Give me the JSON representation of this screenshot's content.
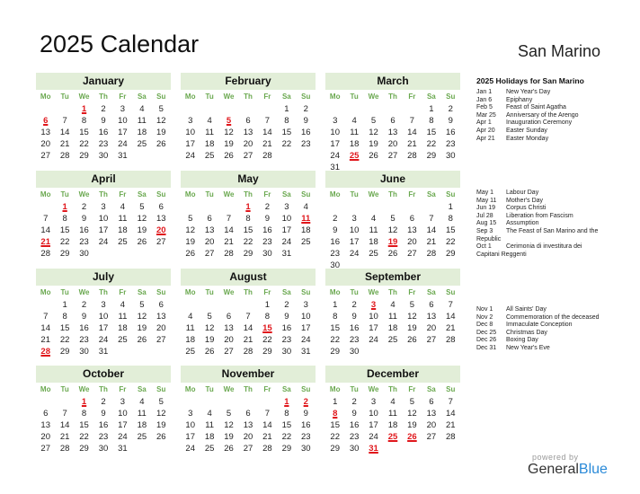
{
  "title": "2025 Calendar",
  "country": "San Marino",
  "weekdays": [
    "Mo",
    "Tu",
    "We",
    "Th",
    "Fr",
    "Sa",
    "Su"
  ],
  "colors": {
    "accent_green": "#6aa84f",
    "header_bg": "#e2eed8",
    "holiday_red": "#e0161b",
    "brand_blue": "#2a8ad8"
  },
  "months": [
    {
      "name": "January",
      "offset": 2,
      "days": 31,
      "holidays": [
        1,
        6
      ]
    },
    {
      "name": "February",
      "offset": 5,
      "days": 28,
      "holidays": [
        5
      ]
    },
    {
      "name": "March",
      "offset": 5,
      "days": 31,
      "holidays": [
        25
      ]
    },
    {
      "name": "April",
      "offset": 1,
      "days": 30,
      "holidays": [
        1,
        20,
        21
      ]
    },
    {
      "name": "May",
      "offset": 3,
      "days": 31,
      "holidays": [
        1,
        11
      ]
    },
    {
      "name": "June",
      "offset": 6,
      "days": 30,
      "holidays": [
        19
      ]
    },
    {
      "name": "July",
      "offset": 1,
      "days": 31,
      "holidays": [
        28
      ]
    },
    {
      "name": "August",
      "offset": 4,
      "days": 31,
      "holidays": [
        15
      ]
    },
    {
      "name": "September",
      "offset": 0,
      "days": 30,
      "holidays": [
        3
      ]
    },
    {
      "name": "October",
      "offset": 2,
      "days": 31,
      "holidays": [
        1
      ]
    },
    {
      "name": "November",
      "offset": 5,
      "days": 30,
      "holidays": [
        1,
        2
      ]
    },
    {
      "name": "December",
      "offset": 0,
      "days": 31,
      "holidays": [
        8,
        25,
        26,
        31
      ]
    }
  ],
  "holidays_heading": "2025 Holidays for San Marino",
  "holiday_groups": [
    [
      {
        "date": "Jan 1",
        "name": "New Year's Day"
      },
      {
        "date": "Jan 6",
        "name": "Epiphany"
      },
      {
        "date": "Feb 5",
        "name": "Feast of Saint Agatha"
      },
      {
        "date": "Mar 25",
        "name": "Anniversary of the Arengo"
      },
      {
        "date": "Apr 1",
        "name": "Inauguration Ceremony"
      },
      {
        "date": "Apr 20",
        "name": "Easter Sunday"
      },
      {
        "date": "Apr 21",
        "name": "Easter Monday"
      }
    ],
    [
      {
        "date": "May 1",
        "name": "Labour Day"
      },
      {
        "date": "May 11",
        "name": "Mother's Day"
      },
      {
        "date": "Jun 19",
        "name": "Corpus Christi"
      },
      {
        "date": "Jul 28",
        "name": "Liberation from Fascism"
      },
      {
        "date": "Aug 15",
        "name": "Assumption"
      },
      {
        "date": "Sep 3",
        "name": "The Feast of San Marino and the",
        "cont": "Republic"
      },
      {
        "date": "Oct 1",
        "name": "Cerimonia di investitura dei",
        "cont": "Capitani Reggenti"
      }
    ],
    [
      {
        "date": "Nov 1",
        "name": "All Saints' Day"
      },
      {
        "date": "Nov 2",
        "name": "Commemoration of the deceased"
      },
      {
        "date": "Dec 8",
        "name": "Immaculate Conception"
      },
      {
        "date": "Dec 25",
        "name": "Christmas Day"
      },
      {
        "date": "Dec 26",
        "name": "Boxing Day"
      },
      {
        "date": "Dec 31",
        "name": "New Year's Eve"
      }
    ]
  ],
  "footer": {
    "powered_by": "powered by",
    "brand_general": "General",
    "brand_blue": "Blue"
  }
}
